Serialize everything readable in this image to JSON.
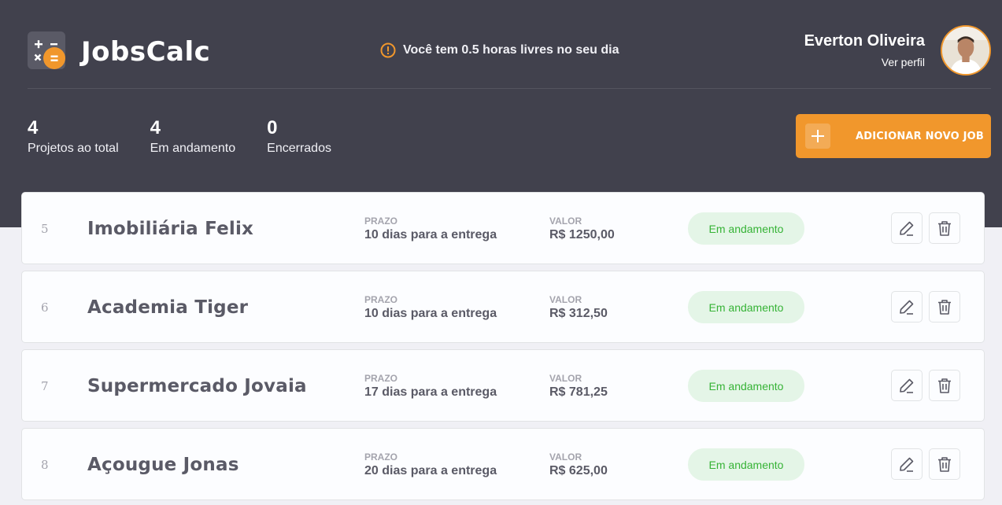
{
  "header": {
    "brand": "JobsCalc",
    "notice": "Você tem 0.5 horas livres no seu dia",
    "user_name": "Everton Oliveira",
    "profile_link": "Ver perfil"
  },
  "stats": [
    {
      "value": "4",
      "label": "Projetos ao total"
    },
    {
      "value": "4",
      "label": "Em andamento"
    },
    {
      "value": "0",
      "label": "Encerrados"
    }
  ],
  "add_button": {
    "label": "ADICIONAR NOVO JOB"
  },
  "jobs": [
    {
      "id": "5",
      "name": "Imobiliária Felix",
      "prazo_label": "PRAZO",
      "prazo": "10 dias para a entrega",
      "valor_label": "VALOR",
      "valor": "R$ 1250,00",
      "status": "Em andamento"
    },
    {
      "id": "6",
      "name": "Academia Tiger",
      "prazo_label": "PRAZO",
      "prazo": "10 dias para a entrega",
      "valor_label": "VALOR",
      "valor": "R$ 312,50",
      "status": "Em andamento"
    },
    {
      "id": "7",
      "name": "Supermercado Jovaia",
      "prazo_label": "PRAZO",
      "prazo": "17 dias para a entrega",
      "valor_label": "VALOR",
      "valor": "R$ 781,25",
      "status": "Em andamento"
    },
    {
      "id": "8",
      "name": "Açougue Jonas",
      "prazo_label": "PRAZO",
      "prazo": "20 dias para a entrega",
      "valor_label": "VALOR",
      "valor": "R$ 625,00",
      "status": "Em andamento"
    }
  ],
  "colors": {
    "accent": "#f1972c",
    "header_bg": "#41414d",
    "status_green": "#36b336",
    "status_bg": "#e4f5e7"
  },
  "icons": {
    "logo": "calculator-icon",
    "notice": "alert-icon",
    "add": "plus-icon",
    "edit": "pencil-icon",
    "delete": "trash-icon"
  }
}
